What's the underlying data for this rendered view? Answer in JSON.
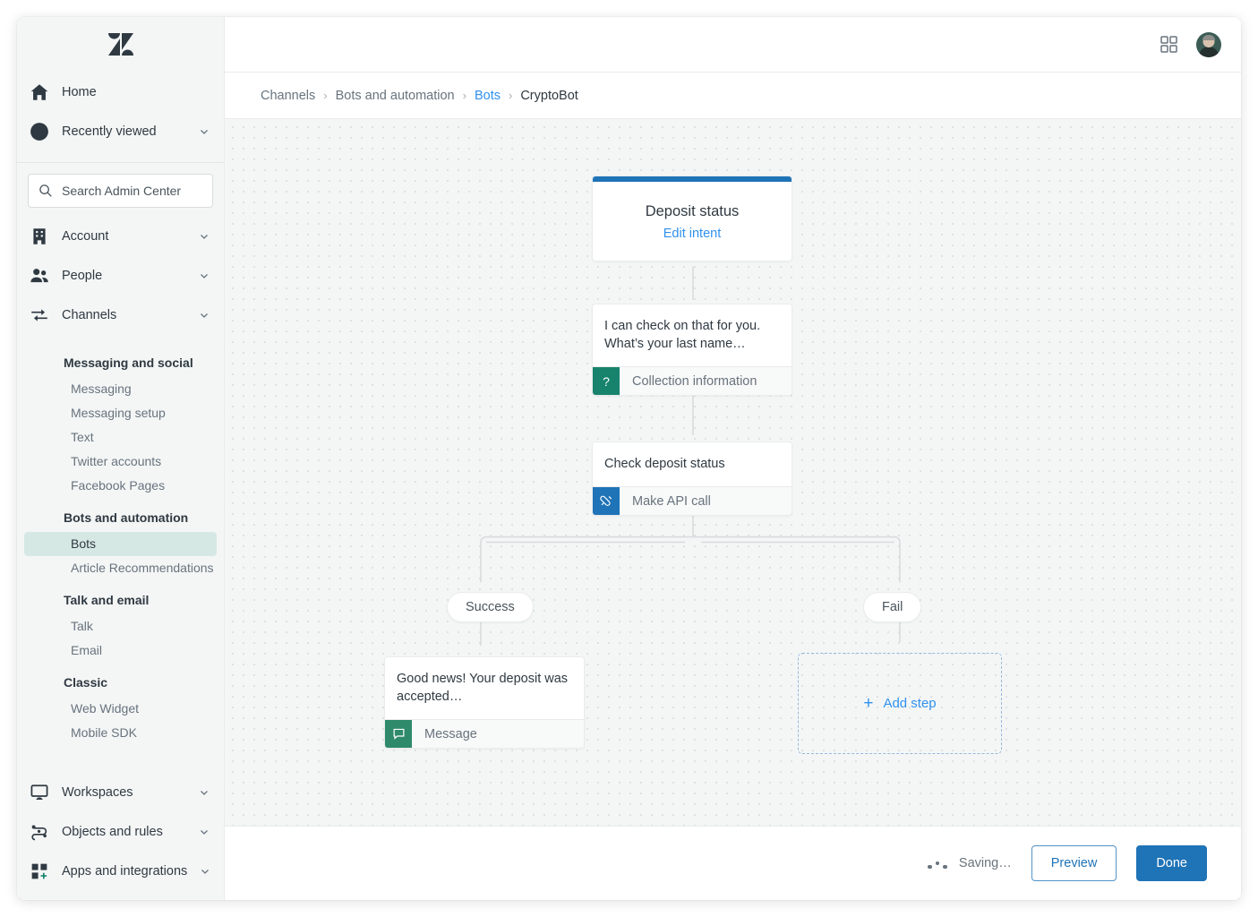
{
  "sidebar": {
    "logo_icon": "zendesk-logo",
    "top_items": [
      {
        "label": "Home",
        "icon": "home-icon",
        "expandable": false
      },
      {
        "label": "Recently viewed",
        "icon": "clock-icon",
        "expandable": true
      }
    ],
    "search": {
      "placeholder": "Search Admin Center",
      "value": "",
      "icon": "search-icon"
    },
    "nav_items": [
      {
        "label": "Account",
        "icon": "building-icon",
        "expandable": true
      },
      {
        "label": "People",
        "icon": "people-icon",
        "expandable": true
      },
      {
        "label": "Channels",
        "icon": "channels-arrows-icon",
        "expandable": true
      }
    ],
    "groups": [
      {
        "title": "Messaging and social",
        "items": [
          {
            "label": "Messaging",
            "active": false
          },
          {
            "label": "Messaging setup",
            "active": false
          },
          {
            "label": "Text",
            "active": false
          },
          {
            "label": "Twitter accounts",
            "active": false
          },
          {
            "label": "Facebook Pages",
            "active": false
          }
        ]
      },
      {
        "title": "Bots and automation",
        "items": [
          {
            "label": "Bots",
            "active": true
          },
          {
            "label": "Article Recommendations",
            "active": false
          }
        ]
      },
      {
        "title": "Talk and email",
        "items": [
          {
            "label": "Talk",
            "active": false
          },
          {
            "label": "Email",
            "active": false
          }
        ]
      },
      {
        "title": "Classic",
        "items": [
          {
            "label": "Web Widget",
            "active": false
          },
          {
            "label": "Mobile SDK",
            "active": false
          }
        ]
      }
    ],
    "bottom_items": [
      {
        "label": "Workspaces",
        "icon": "monitor-icon",
        "expandable": true
      },
      {
        "label": "Objects and rules",
        "icon": "objects-rules-icon",
        "expandable": true
      },
      {
        "label": "Apps and integrations",
        "icon": "apps-plus-icon",
        "expandable": true
      }
    ]
  },
  "topbar": {
    "grid_icon": "apps-grid-icon",
    "avatar_icon": "user-avatar"
  },
  "breadcrumb": {
    "items": [
      {
        "label": "Channels",
        "type": "muted"
      },
      {
        "label": "Bots and automation",
        "type": "muted"
      },
      {
        "label": "Bots",
        "type": "link"
      },
      {
        "label": "CryptoBot",
        "type": "current"
      }
    ],
    "separator": "›"
  },
  "flow": {
    "intent_node": {
      "title": "Deposit status",
      "link": "Edit intent",
      "accent_color": "#1f73b7"
    },
    "steps": [
      {
        "id": "collection",
        "text": "I can check on that for you. What’s your last name…",
        "type_label": "Collection information",
        "icon": "question-mark-icon",
        "icon_color": "#17836d"
      },
      {
        "id": "api",
        "text": "Check deposit status",
        "type_label": "Make API call",
        "icon": "api-plug-icon",
        "icon_color": "#1f73b7"
      },
      {
        "id": "message",
        "text": "Good news! Your deposit was accepted…",
        "type_label": "Message",
        "icon": "message-bubble-icon",
        "icon_color": "#2e8a6a"
      }
    ],
    "branches": [
      {
        "label": "Success"
      },
      {
        "label": "Fail"
      }
    ],
    "add_step": {
      "label": "Add step",
      "icon": "plus-icon"
    }
  },
  "footer": {
    "status_text": "Saving…",
    "spinner_icon": "loading-dots-icon",
    "preview_label": "Preview",
    "done_label": "Done"
  }
}
